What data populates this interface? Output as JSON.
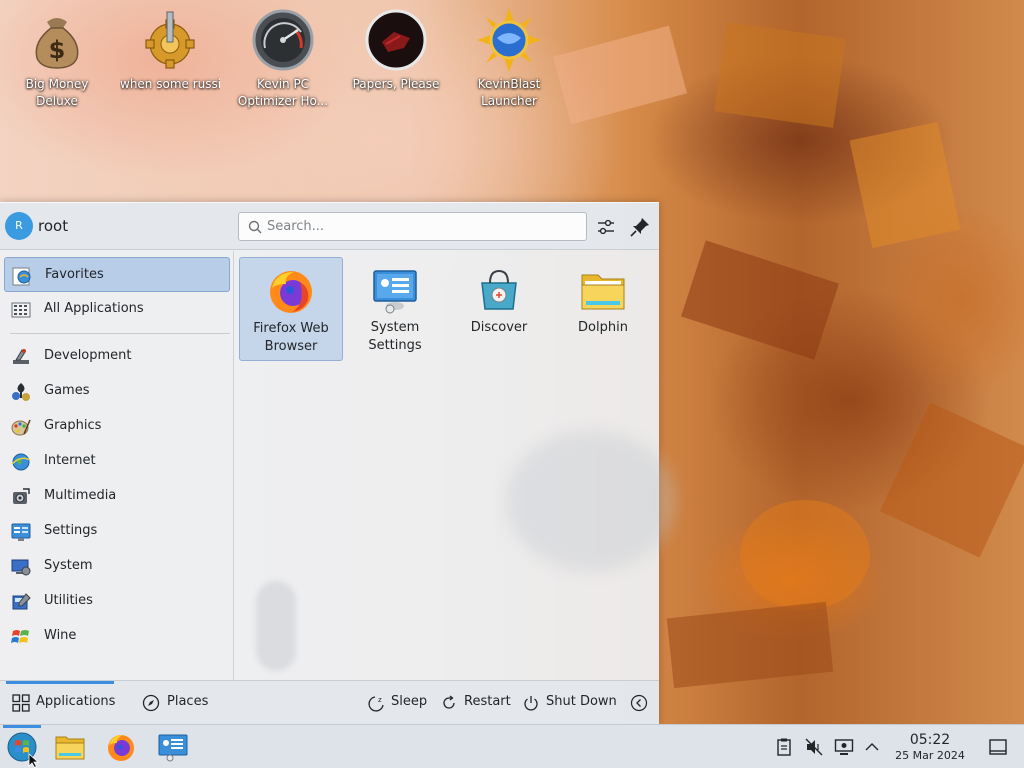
{
  "desktop": {
    "icons": [
      {
        "label": "Big Money Deluxe",
        "icon": "money-bag-icon"
      },
      {
        "label": "when some russian runs a...",
        "icon": "gear-icon"
      },
      {
        "label": "Kevin PC Optimizer Ho...",
        "icon": "speedometer-icon"
      },
      {
        "label": "Papers, Please",
        "icon": "papers-please-icon"
      },
      {
        "label": "KevinBlast Launcher",
        "icon": "kevinblast-icon"
      }
    ]
  },
  "launcher": {
    "user": {
      "avatar_letter": "R",
      "name": "root"
    },
    "search": {
      "placeholder": "Search..."
    },
    "header_buttons": {
      "configure": "configure-icon",
      "pin": "pin-icon"
    },
    "categories": [
      {
        "label": "Favorites",
        "icon": "favorites-icon",
        "active": true
      },
      {
        "label": "All Applications",
        "icon": "all-apps-icon"
      },
      {
        "label": "Development",
        "icon": "development-icon"
      },
      {
        "label": "Games",
        "icon": "games-icon"
      },
      {
        "label": "Graphics",
        "icon": "graphics-icon"
      },
      {
        "label": "Internet",
        "icon": "internet-icon"
      },
      {
        "label": "Multimedia",
        "icon": "multimedia-icon"
      },
      {
        "label": "Settings",
        "icon": "settings-icon"
      },
      {
        "label": "System",
        "icon": "system-icon"
      },
      {
        "label": "Utilities",
        "icon": "utilities-icon"
      },
      {
        "label": "Wine",
        "icon": "wine-icon"
      }
    ],
    "favorites": [
      {
        "label_line1": "Firefox Web",
        "label_line2": "Browser",
        "icon": "firefox-icon",
        "selected": true
      },
      {
        "label_line1": "System",
        "label_line2": "Settings",
        "icon": "system-settings-icon"
      },
      {
        "label_line1": "Discover",
        "label_line2": "",
        "icon": "discover-icon"
      },
      {
        "label_line1": "Dolphin",
        "label_line2": "",
        "icon": "folder-icon"
      }
    ],
    "footer": {
      "tabs": [
        {
          "label": "Applications",
          "icon": "grid-icon",
          "active": true
        },
        {
          "label": "Places",
          "icon": "compass-icon"
        }
      ],
      "power": [
        {
          "label": "Sleep",
          "icon": "sleep-icon"
        },
        {
          "label": "Restart",
          "icon": "restart-icon"
        },
        {
          "label": "Shut Down",
          "icon": "power-icon"
        }
      ],
      "more_icon": "chevron-left-icon"
    }
  },
  "taskbar": {
    "items": [
      {
        "icon": "start-menu-icon",
        "active": true
      },
      {
        "icon": "folder-icon"
      },
      {
        "icon": "firefox-icon"
      },
      {
        "icon": "system-settings-icon"
      }
    ],
    "tray": [
      "clipboard-icon",
      "volume-muted-icon",
      "display-icon",
      "chevron-up-icon"
    ],
    "clock": {
      "time": "05:22",
      "date": "25 Mar 2024"
    },
    "show_desktop_icon": "show-desktop-icon"
  },
  "colors": {
    "accent": "#3d8ee0",
    "selection": "#b7cde8"
  }
}
